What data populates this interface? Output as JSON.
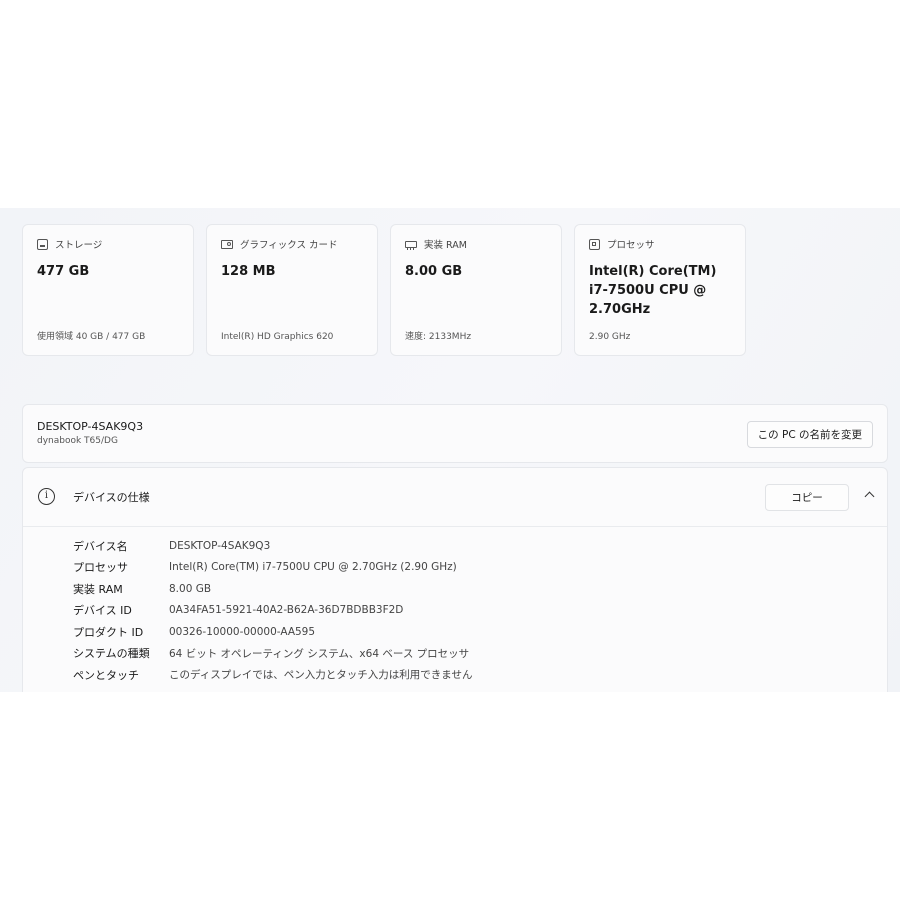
{
  "cards": [
    {
      "icon": "storage-icon",
      "label": "ストレージ",
      "value": "477 GB",
      "sub": "使用領域 40 GB / 477 GB"
    },
    {
      "icon": "graphics-card-icon",
      "label": "グラフィックス カード",
      "value": "128 MB",
      "sub": "Intel(R) HD Graphics 620"
    },
    {
      "icon": "ram-icon",
      "label": "実装 RAM",
      "value": "8.00 GB",
      "sub": "速度: 2133MHz"
    },
    {
      "icon": "processor-icon",
      "label": "プロセッサ",
      "value": "Intel(R) Core(TM) i7-7500U CPU @ 2.70GHz",
      "sub": "2.90 GHz"
    }
  ],
  "device": {
    "name": "DESKTOP-4SAK9Q3",
    "model": "dynabook T65/DG",
    "rename_label": "この PC の名前を変更"
  },
  "spec": {
    "title": "デバイスの仕様",
    "copy_label": "コピー",
    "rows": [
      {
        "key": "デバイス名",
        "value": "DESKTOP-4SAK9Q3"
      },
      {
        "key": "プロセッサ",
        "value": "Intel(R) Core(TM) i7-7500U CPU @ 2.70GHz (2.90 GHz)"
      },
      {
        "key": "実装 RAM",
        "value": "8.00 GB"
      },
      {
        "key": "デバイス ID",
        "value": "0A34FA51-5921-40A2-B62A-36D7BDBB3F2D"
      },
      {
        "key": "プロダクト ID",
        "value": "00326-10000-00000-AA595"
      },
      {
        "key": "システムの種類",
        "value": "64 ビット オペレーティング システム、x64 ベース プロセッサ"
      },
      {
        "key": "ペンとタッチ",
        "value": "このディスプレイでは、ペン入力とタッチ入力は利用できません"
      }
    ]
  }
}
